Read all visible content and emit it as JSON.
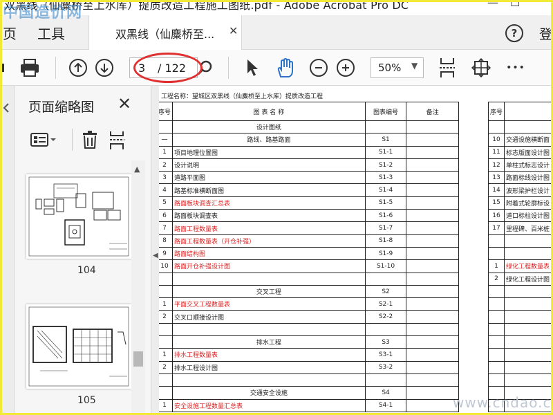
{
  "window": {
    "title": "双黑线（仙麋桥至上水库）提质改造工程施工图纸.pdf - Adobe Acrobat Pro DC",
    "minimize_glyph": "—",
    "maximize_glyph": "☐"
  },
  "watermarks": {
    "top_left": "中国造价网",
    "bottom_right": "www.cndao.com"
  },
  "tabs": {
    "home_label": "页",
    "tools_label": "工具",
    "document_tab_label": "双黑线（仙麋桥至...",
    "close_glyph": "✕",
    "help_glyph": "?",
    "login_label": "登"
  },
  "toolbar": {
    "page_current": "3",
    "page_total": "/ 122",
    "zoom_value": "50%",
    "more_glyph": "•••"
  },
  "side_panel": {
    "title": "页面缩略图",
    "close_glyph": "✕",
    "thumbnails": [
      {
        "label": "104"
      },
      {
        "label": "105"
      }
    ]
  },
  "document": {
    "project_name": "工程名称：望城区双黑线（仙麋桥至上水库）提质改造工程",
    "left_table": {
      "headers": [
        "序号",
        "图 表 名 称",
        "图表编号",
        "备注"
      ],
      "rows": [
        {
          "no": "",
          "name": "设计图纸",
          "code": "",
          "note": "",
          "center": true,
          "red": false
        },
        {
          "no": "一",
          "name": "路线、路基路面",
          "code": "S1",
          "note": "",
          "center": true,
          "red": false
        },
        {
          "no": "1",
          "name": "项目地理位置图",
          "code": "S1-1",
          "note": "",
          "center": false,
          "red": false
        },
        {
          "no": "2",
          "name": "设计说明",
          "code": "S1-2",
          "note": "",
          "center": false,
          "red": false
        },
        {
          "no": "3",
          "name": "道路平面图",
          "code": "S1-3",
          "note": "",
          "center": false,
          "red": false
        },
        {
          "no": "4",
          "name": "路基标准横断面图",
          "code": "S1-4",
          "note": "",
          "center": false,
          "red": false
        },
        {
          "no": "5",
          "name": "路面板块调查汇总表",
          "code": "S1-5",
          "note": "",
          "center": false,
          "red": true
        },
        {
          "no": "6",
          "name": "路面板块调查表",
          "code": "S1-6",
          "note": "",
          "center": false,
          "red": false
        },
        {
          "no": "7",
          "name": "路面工程数量表",
          "code": "S1-7",
          "note": "",
          "center": false,
          "red": true
        },
        {
          "no": "8",
          "name": "路面工程数量表（开仓补强）",
          "code": "S1-8",
          "note": "",
          "center": false,
          "red": true
        },
        {
          "no": "9",
          "name": "路面结构图",
          "code": "S1-9",
          "note": "",
          "center": false,
          "red": true
        },
        {
          "no": "10",
          "name": "路面开仓补强设计图",
          "code": "S1-10",
          "note": "",
          "center": false,
          "red": true
        },
        {
          "no": "",
          "name": "",
          "code": "",
          "note": "",
          "center": false,
          "red": false
        },
        {
          "no": "",
          "name": "交叉工程",
          "code": "S2",
          "note": "",
          "center": true,
          "red": false
        },
        {
          "no": "1",
          "name": "平面交叉工程数量表",
          "code": "S2-1",
          "note": "",
          "center": false,
          "red": true
        },
        {
          "no": "2",
          "name": "交叉口顺接设计图",
          "code": "S2-2",
          "note": "",
          "center": false,
          "red": false
        },
        {
          "no": "",
          "name": "",
          "code": "",
          "note": "",
          "center": false,
          "red": false
        },
        {
          "no": "",
          "name": "排水工程",
          "code": "S3",
          "note": "",
          "center": true,
          "red": false
        },
        {
          "no": "1",
          "name": "排水工程数量表",
          "code": "S3-1",
          "note": "",
          "center": false,
          "red": true
        },
        {
          "no": "2",
          "name": "排水工程设计图",
          "code": "S3-2",
          "note": "",
          "center": false,
          "red": false
        },
        {
          "no": "",
          "name": "",
          "code": "",
          "note": "",
          "center": false,
          "red": false
        },
        {
          "no": "",
          "name": "交通安全设施",
          "code": "S4",
          "note": "",
          "center": true,
          "red": false
        },
        {
          "no": "1",
          "name": "安全设施工程数量汇总表",
          "code": "S4-1",
          "note": "",
          "center": false,
          "red": true
        }
      ]
    },
    "right_table": {
      "header": "序号",
      "rows": [
        {
          "no": "",
          "name": "",
          "red": false
        },
        {
          "no": "10",
          "name": "交通设施横断面",
          "red": false
        },
        {
          "no": "11",
          "name": "标志版面设计图",
          "red": false
        },
        {
          "no": "12",
          "name": "单柱式标志设计",
          "red": false
        },
        {
          "no": "13",
          "name": "路面标线设计图",
          "red": false
        },
        {
          "no": "14",
          "name": "波形梁护栏设计",
          "red": false
        },
        {
          "no": "15",
          "name": "附着式轮廓标设",
          "red": false
        },
        {
          "no": "16",
          "name": "道口标柱设计图",
          "red": false
        },
        {
          "no": "17",
          "name": "里程碑、百米桩",
          "red": false
        },
        {
          "no": "",
          "name": "",
          "red": false
        },
        {
          "no": "",
          "name": "",
          "red": false
        },
        {
          "no": "1",
          "name": "绿化工程数量表",
          "red": true
        },
        {
          "no": "2",
          "name": "绿化工程设计图",
          "red": false
        },
        {
          "no": "",
          "name": "",
          "red": false
        },
        {
          "no": "",
          "name": "",
          "red": false
        },
        {
          "no": "",
          "name": "",
          "red": false
        },
        {
          "no": "",
          "name": "",
          "red": false
        },
        {
          "no": "",
          "name": "",
          "red": false
        },
        {
          "no": "",
          "name": "",
          "red": false
        },
        {
          "no": "",
          "name": "",
          "red": false
        },
        {
          "no": "",
          "name": "",
          "red": false
        },
        {
          "no": "",
          "name": "",
          "red": false
        },
        {
          "no": "",
          "name": "",
          "red": false
        }
      ]
    }
  },
  "colors": {
    "frame_yellow": "#f2ea35",
    "annotation_red": "#e03030",
    "hand_tool_blue": "#2b72c9",
    "red_text": "#e02020"
  }
}
